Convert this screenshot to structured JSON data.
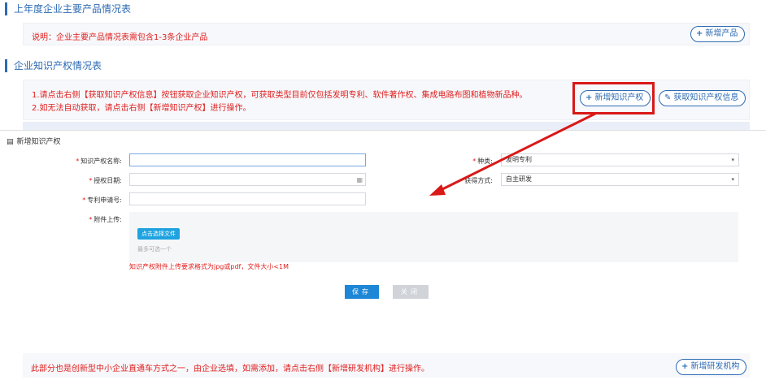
{
  "section1": {
    "title": "上年度企业主要产品情况表",
    "note": "说明：企业主要产品情况表需包含1-3条企业产品",
    "add_button": "新增产品"
  },
  "section2": {
    "title": "企业知识产权情况表",
    "note_line1": "1.请点击右侧【获取知识产权信息】按钮获取企业知识产权，可获取类型目前仅包括发明专利、软件著作权、集成电路布图和植物新品种。",
    "note_line2": "2.如无法自动获取，请点击右侧【新增知识产权】进行操作。",
    "add_button": "新增知识产权",
    "fetch_button": "获取知识产权信息"
  },
  "modal": {
    "title": "新增知识产权",
    "fields": {
      "name_label": "知识产权名称:",
      "name_value": "",
      "type_label": "种类:",
      "type_value": "发明专利",
      "grant_date_label": "授权日期:",
      "grant_date_value": "",
      "acquire_label": "获得方式:",
      "acquire_value": "自主研发",
      "patent_no_label": "专利申请号:",
      "patent_no_value": "",
      "attachment_label": "附件上传:"
    },
    "upload_button": "点击选择文件",
    "upload_hint": "最多可选一个",
    "upload_requirement": "知识产权附件上传要求格式为jpg或pdf，文件大小<1M",
    "save_button": "保存",
    "close_button": "关闭"
  },
  "section3": {
    "note": "此部分也是创新型中小企业直通车方式之一，由企业选填，如需添加，请点击右侧【新增研发机构】进行操作。",
    "add_button": "新增研发机构"
  },
  "colors": {
    "accent": "#2d6bb3",
    "warning_red": "#e02020",
    "highlight_red": "#d91818",
    "save_blue": "#1e86d6"
  }
}
